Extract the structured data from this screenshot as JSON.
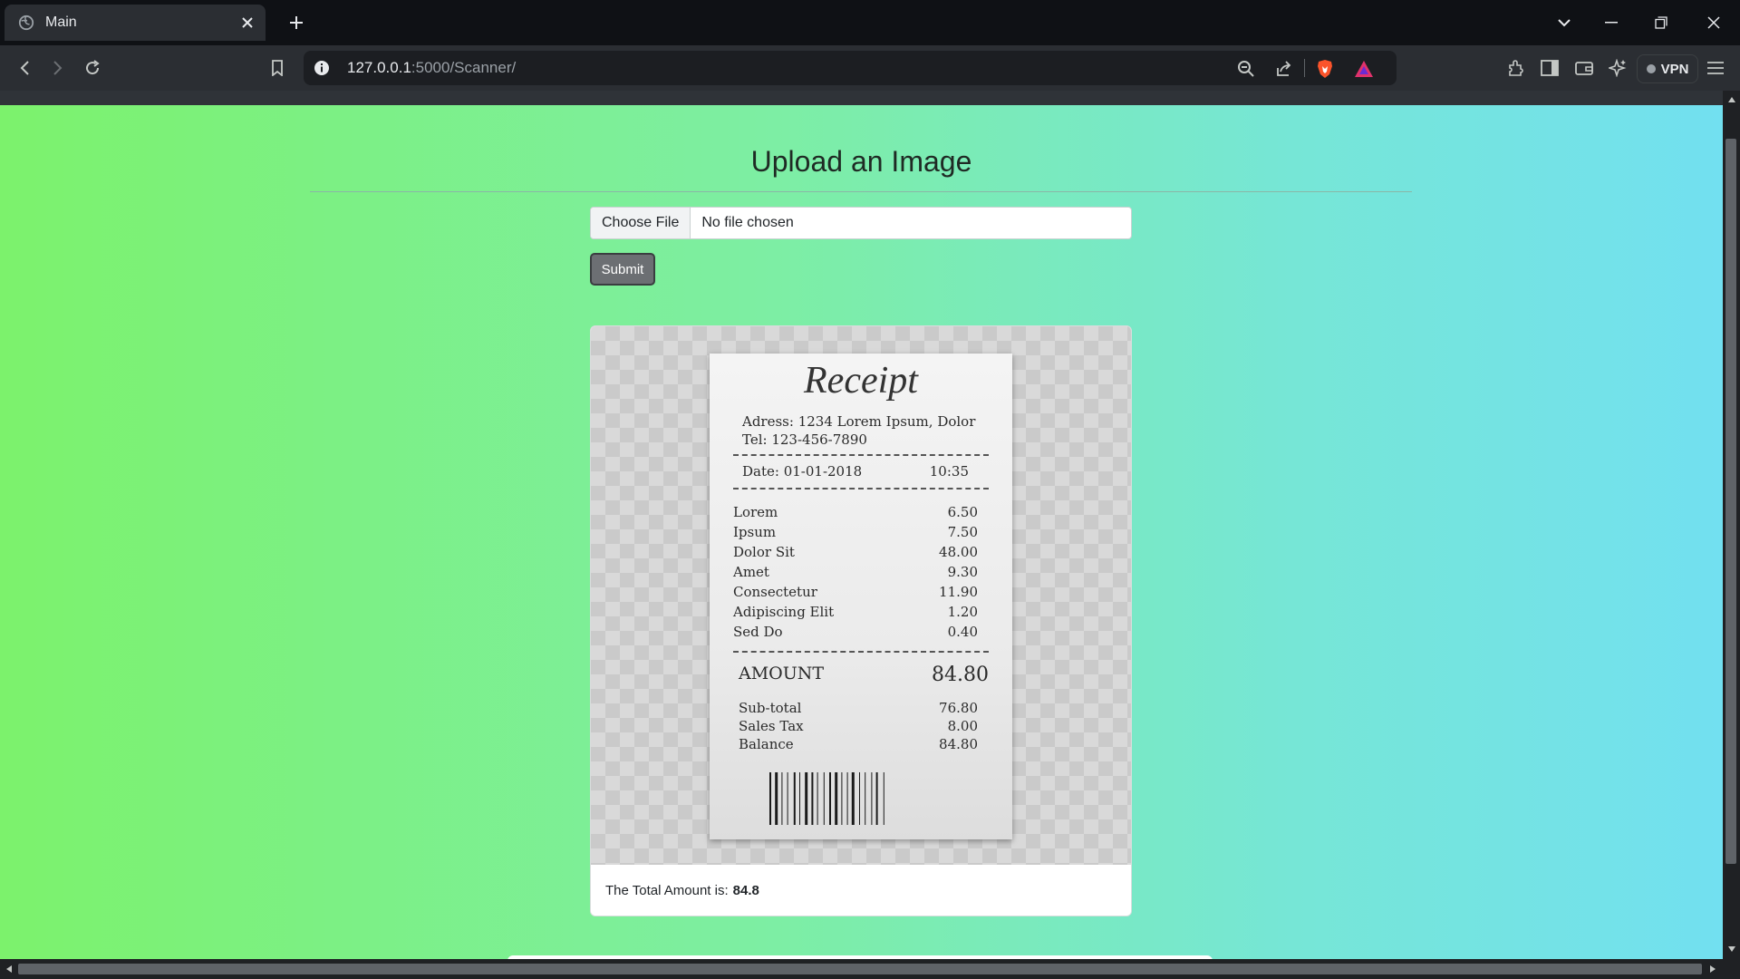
{
  "browser": {
    "tab_title": "Main",
    "url_host": "127.0.0.1",
    "url_path": ":5000/Scanner/",
    "vpn_label": "VPN"
  },
  "page": {
    "heading": "Upload an Image",
    "file_button_label": "Choose File",
    "file_status": "No file chosen",
    "submit_label": "Submit",
    "result_label": "The Total Amount is:",
    "result_value": "84.8"
  },
  "receipt": {
    "title": "Receipt",
    "address": "Adress: 1234 Lorem Ipsum, Dolor",
    "tel": "Tel: 123-456-7890",
    "date": "Date: 01-01-2018",
    "time": "10:35",
    "items": [
      {
        "name": "Lorem",
        "price": "6.50"
      },
      {
        "name": "Ipsum",
        "price": "7.50"
      },
      {
        "name": "Dolor Sit",
        "price": "48.00"
      },
      {
        "name": "Amet",
        "price": "9.30"
      },
      {
        "name": "Consectetur",
        "price": "11.90"
      },
      {
        "name": "Adipiscing Elit",
        "price": "1.20"
      },
      {
        "name": "Sed Do",
        "price": "0.40"
      }
    ],
    "amount_label": "AMOUNT",
    "amount_value": "84.80",
    "subtotal_label": "Sub-total",
    "subtotal_value": "76.80",
    "tax_label": "Sales Tax",
    "tax_value": "8.00",
    "balance_label": "Balance",
    "balance_value": "84.80"
  },
  "colors": {
    "gradient_start": "#7cf26c",
    "gradient_end": "#72e0f0",
    "submit_bg": "#6c6f73"
  }
}
